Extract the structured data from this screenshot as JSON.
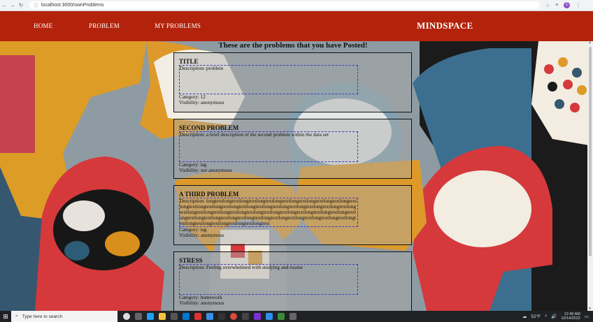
{
  "browser": {
    "url": "localhost:3000/ownProblems"
  },
  "navbar": {
    "links": [
      "HOME",
      "PROBLEM",
      "MY PROBLEMS"
    ],
    "brand": "MINDSPACE"
  },
  "page": {
    "heading": "These are the problems that you have Posted!"
  },
  "problems": [
    {
      "title": "TITLE",
      "description": "Description: problem",
      "category": "Category: 12",
      "visibility": "Visibility: anonymous"
    },
    {
      "title": "SECOND PROBLEM",
      "description": "Description: a brief description of the second problem within the data set",
      "category": "Category: tag",
      "visibility": "Visibility: not anonymous"
    },
    {
      "title": "A THIRD PROBLEM",
      "description": "Description: longtextlongtextlongtextlongtextlongtextlongtextlongtextlongtextlongtextlongtextlongtextlongtextlongtextlongtextlongtextlongtextlongtextlongtextlongtextlongtextlongtextlongtextlongtextlongtextlongtextlongtextlongtextlongtextlongtextlongtextlongtextlongtextlongtextlongtextlongtextlongtextlongtextlongtextlongtextlongtextlongtextlongtextlongtextlongtextlongtextlongtext",
      "category": "Category: tag",
      "visibility": "Visibility: anonymous"
    },
    {
      "title": "STRESS",
      "description": "Description: Feeling overwhelmed with studying and exams",
      "category": "Category: homework",
      "visibility": "Visibility: anonymous"
    }
  ],
  "taskbar": {
    "search_placeholder": "Type here to search",
    "weather": "52°F",
    "time": "12:49 AM",
    "date": "10/14/2022"
  },
  "colors": {
    "navbar": "#b3230b",
    "card_border": "#111111",
    "desc_border": "#3b3bbb"
  }
}
